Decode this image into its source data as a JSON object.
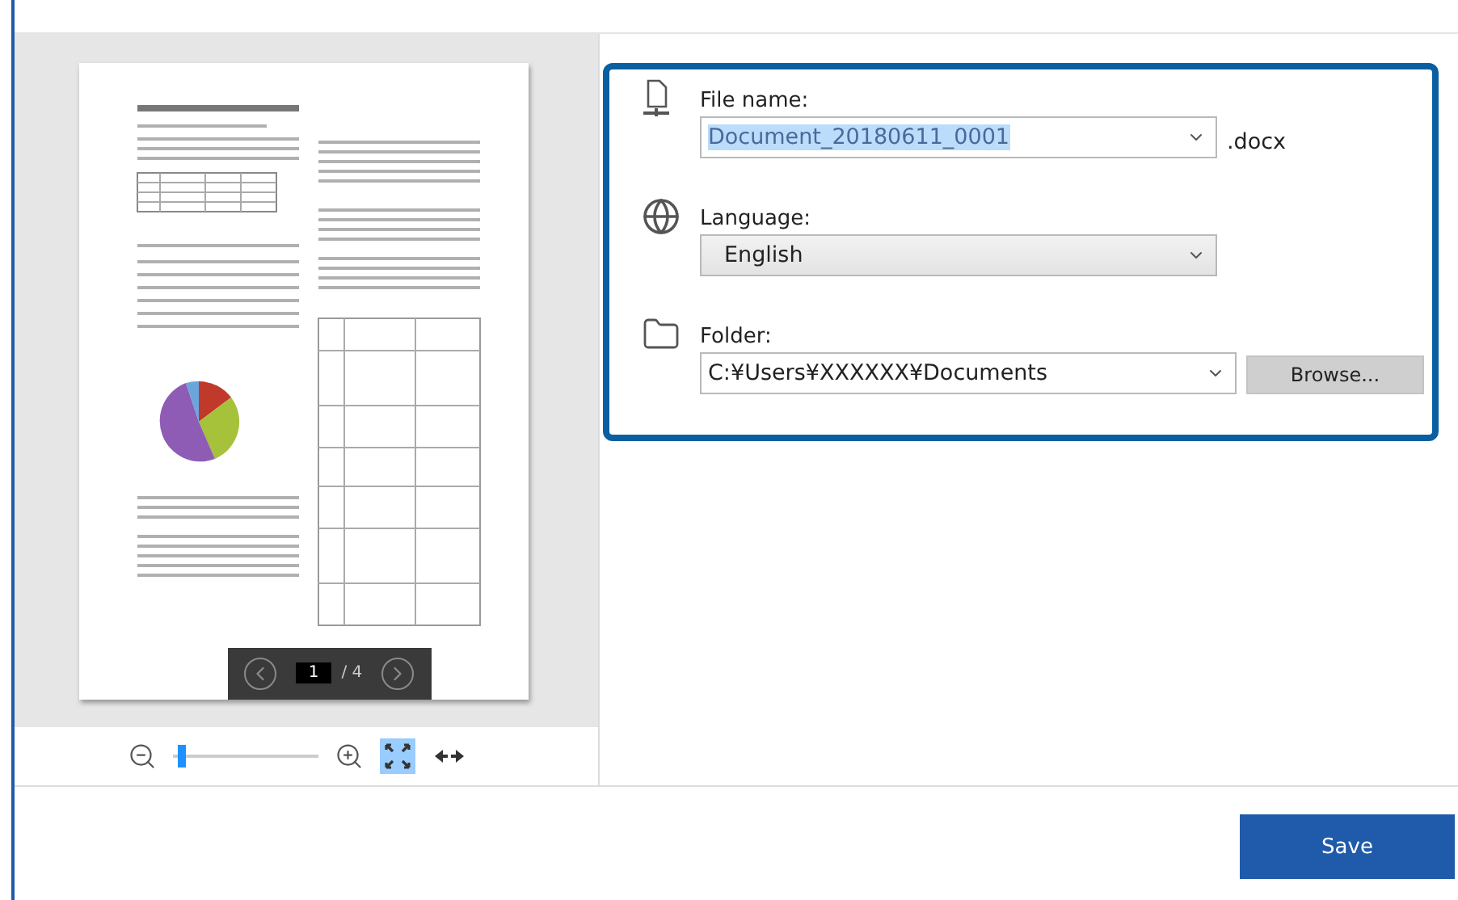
{
  "preview": {
    "page": "1",
    "page_total": "/ 4"
  },
  "zoom": {
    "level": 0.03
  },
  "view_modes": [
    {
      "kind": "fit_page",
      "selected": true
    },
    {
      "kind": "fit_width",
      "selected": false
    }
  ],
  "settings": [
    {
      "kind": "filename",
      "label": "File name:",
      "value": "Document_20180611_0001",
      "highlighted": true,
      "suffix": ".docx"
    },
    {
      "kind": "language",
      "label": "Language:",
      "value": "English"
    },
    {
      "kind": "folder",
      "label": "Folder:",
      "value": "C:¥Users¥XXXXXX¥Documents",
      "button": "Browse..."
    }
  ],
  "save_button": "Save"
}
